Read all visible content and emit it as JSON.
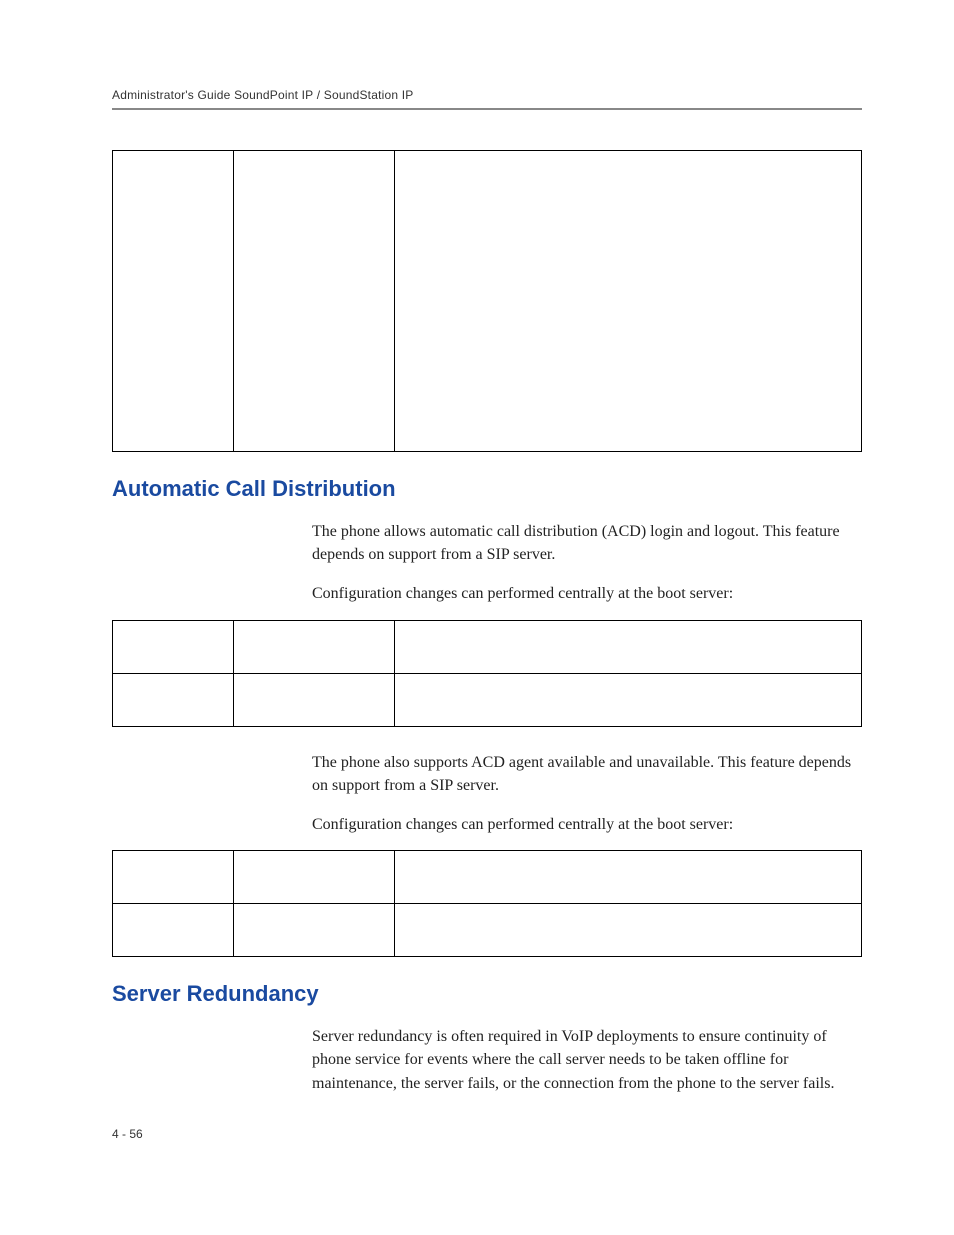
{
  "header": "Administrator's Guide SoundPoint IP / SoundStation IP",
  "table1": {
    "rows": [
      {
        "c1": "",
        "c2": "",
        "c3": ""
      }
    ]
  },
  "section_acd": {
    "title": "Automatic Call Distribution",
    "para1": "The phone allows automatic call distribution (ACD) login and logout. This feature depends on support from a SIP server.",
    "para2": "Configuration changes can performed centrally at the boot server:",
    "table": {
      "rows": [
        {
          "c1": "",
          "c2": "",
          "c3": ""
        },
        {
          "c1": "",
          "c2": "",
          "c3": ""
        }
      ]
    },
    "para3": "The phone also supports ACD agent available and unavailable. This feature depends on support from a SIP server.",
    "para4": "Configuration changes can performed centrally at the boot server:",
    "table2": {
      "rows": [
        {
          "c1": "",
          "c2": "",
          "c3": ""
        },
        {
          "c1": "",
          "c2": "",
          "c3": ""
        }
      ]
    }
  },
  "section_server": {
    "title": "Server Redundancy",
    "para1": "Server redundancy is often required in VoIP deployments to ensure continuity of phone service for events where the call server needs to be taken offline for maintenance, the server fails, or the connection from the phone to the server fails."
  },
  "footer": "4 - 56"
}
